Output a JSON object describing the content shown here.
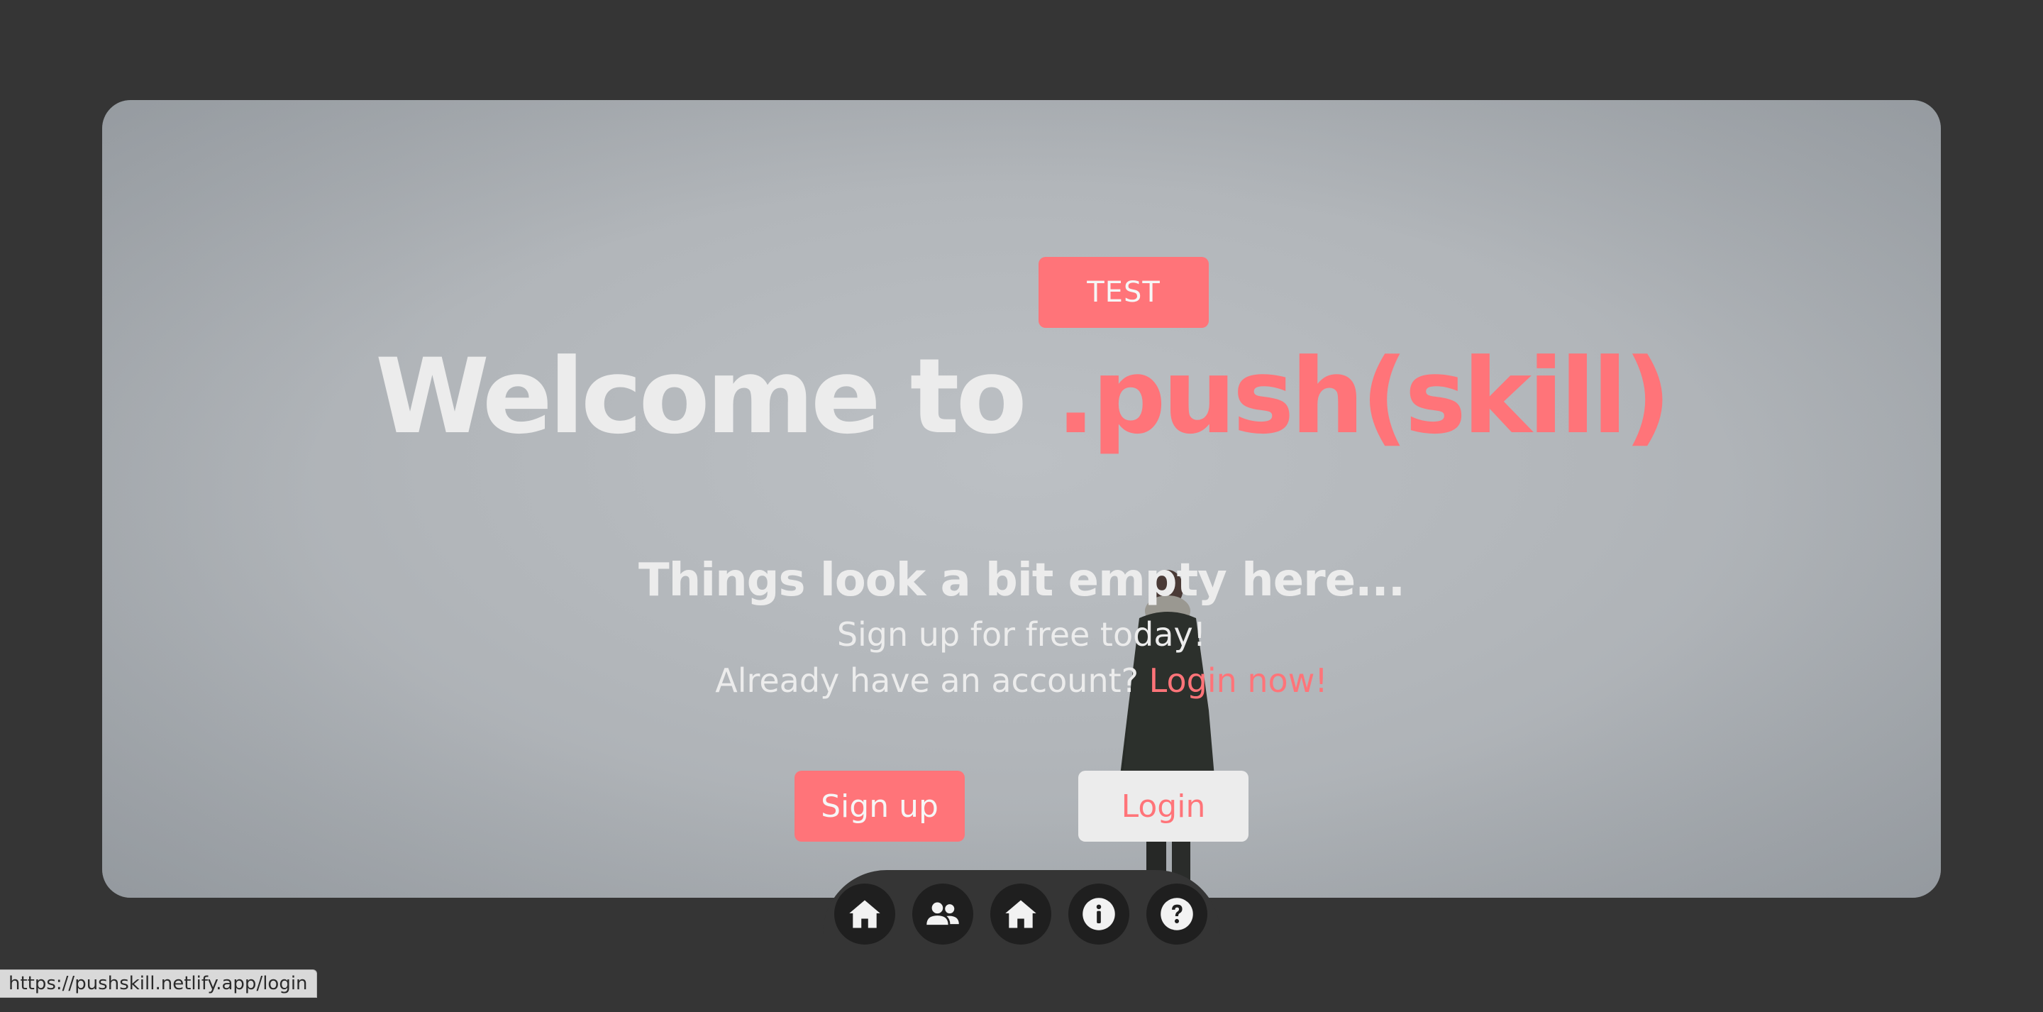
{
  "hero": {
    "tag_label": "TEST",
    "headline_prefix": "Welcome to ",
    "headline_brand": ".push(skill)",
    "empty_title": "Things look a bit empty here...",
    "signup_line": "Sign up for free today!",
    "account_question": "Already have an account? ",
    "login_link": "Login now!"
  },
  "actions": {
    "signup_label": "Sign up",
    "login_label": "Login"
  },
  "nav": {
    "icons": [
      "home-icon",
      "users-icon",
      "home-icon",
      "info-icon",
      "help-icon"
    ]
  },
  "status_bar": {
    "url": "https://pushskill.netlify.app/login"
  },
  "colors": {
    "background": "#353535",
    "accent": "#ff7479",
    "text_light": "#ececec",
    "nav_circle": "#1f1f1f"
  }
}
